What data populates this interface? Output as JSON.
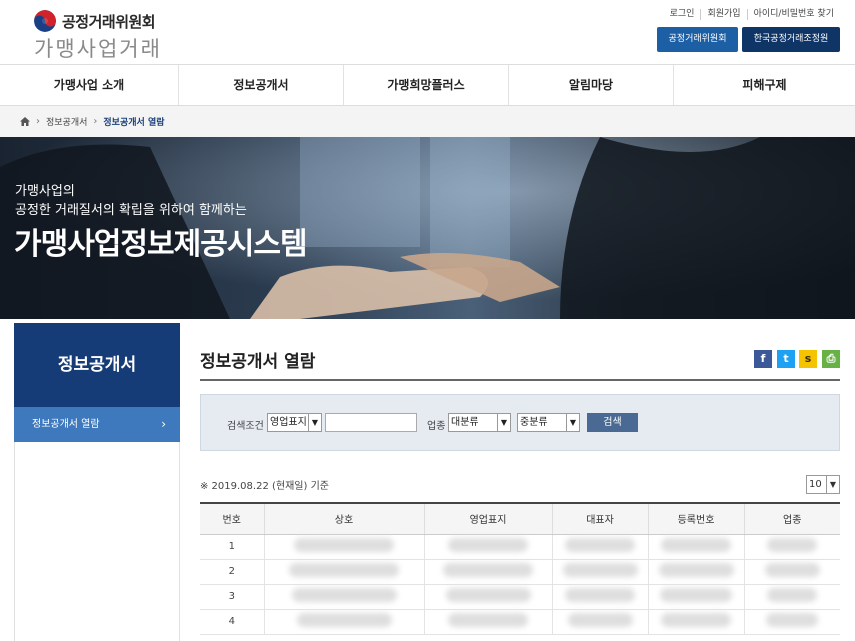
{
  "header": {
    "org_name": "공정거래위원회",
    "site_name": "가맹사업거래",
    "util_links": [
      "로그인",
      "회원가입",
      "아이디/비밀번호 찾기"
    ],
    "ext_buttons": [
      "공정거래위원회",
      "한국공정거래조정원"
    ]
  },
  "gnb": [
    "가맹사업 소개",
    "정보공개서",
    "가맹희망플러스",
    "알림마당",
    "피해구제"
  ],
  "breadcrumb": {
    "home_icon": "home-icon",
    "items": [
      "정보공개서",
      "정보공개서 열람"
    ]
  },
  "banner": {
    "line1": "가맹사업의",
    "line2": "공정한 거래질서의 확립을 위하여 함께하는",
    "title": "가맹사업정보제공시스템"
  },
  "lnb": {
    "title": "정보공개서",
    "items": [
      {
        "label": "정보공개서 열람",
        "active": true
      }
    ]
  },
  "content": {
    "title": "정보공개서 열람",
    "share_icons": [
      "facebook-icon",
      "twitter-icon",
      "kakaostory-icon",
      "print-icon"
    ],
    "search": {
      "condition_label": "검색조건",
      "condition_value": "영업표지",
      "keyword_value": "",
      "category_label": "업종",
      "major_value": "대분류",
      "middle_value": "중분류",
      "button": "검색"
    },
    "basis": "※ 2019.08.22 (현재일) 기준",
    "page_size": "10",
    "table": {
      "headers": [
        "번호",
        "상호",
        "영업표지",
        "대표자",
        "등록번호",
        "업종"
      ],
      "rows": [
        {
          "no": "1"
        },
        {
          "no": "2"
        },
        {
          "no": "3"
        },
        {
          "no": "4"
        }
      ]
    }
  },
  "colors": {
    "navy": "#163c78",
    "accent_blue": "#3e78bd",
    "ext_btn1": "#1d5fa5",
    "ext_btn2": "#0f3466"
  }
}
